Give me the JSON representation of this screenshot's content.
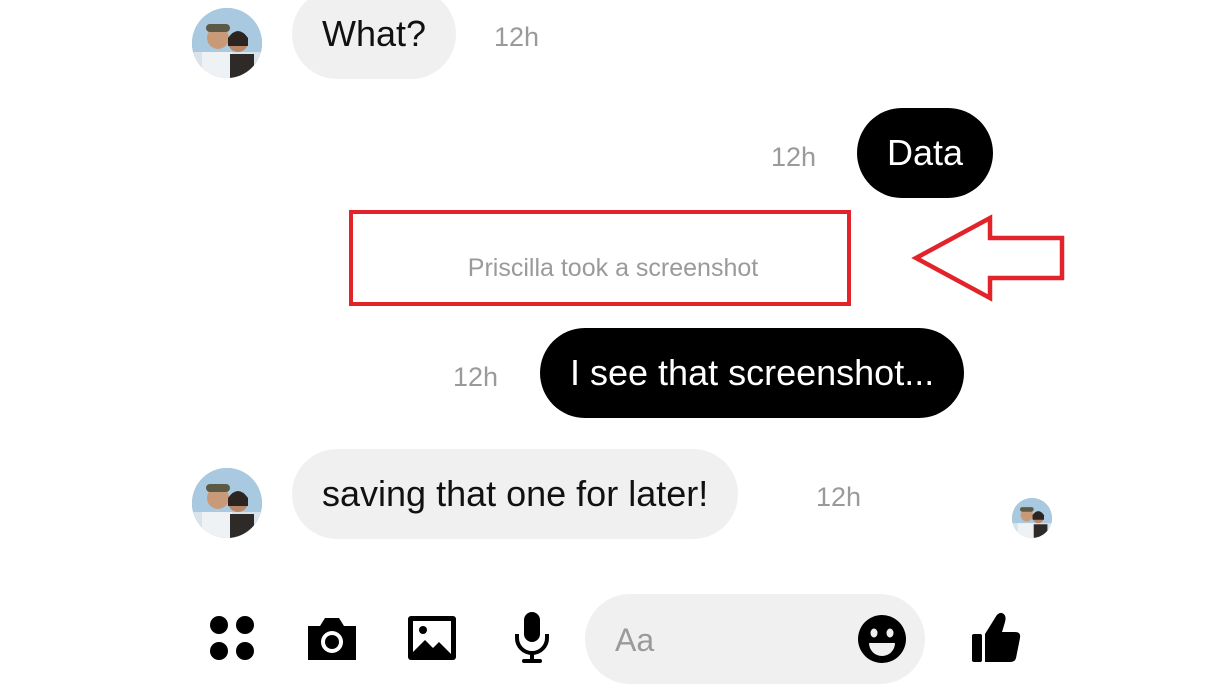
{
  "conversation": {
    "messages": [
      {
        "direction": "incoming",
        "text": "What?",
        "time": "12h"
      },
      {
        "direction": "outgoing",
        "text": "Data",
        "time": "12h"
      },
      {
        "direction": "outgoing",
        "text": "I see that screenshot...",
        "time": "12h"
      },
      {
        "direction": "incoming",
        "text": "saving that one for later!",
        "time": "12h"
      }
    ],
    "notice": "Priscilla took a screenshot"
  },
  "composer": {
    "placeholder": "Aa"
  },
  "annotation": {
    "highlight_color": "#e2232a"
  },
  "icons": {
    "apps": "apps-grid-icon",
    "camera": "camera-icon",
    "gallery": "image-gallery-icon",
    "mic": "microphone-icon",
    "emoji": "emoji-icon",
    "like": "thumbs-up-icon"
  },
  "colors": {
    "incoming_bubble": "#f0f0f0",
    "outgoing_bubble": "#000000",
    "timestamp": "#9a9a9a"
  }
}
